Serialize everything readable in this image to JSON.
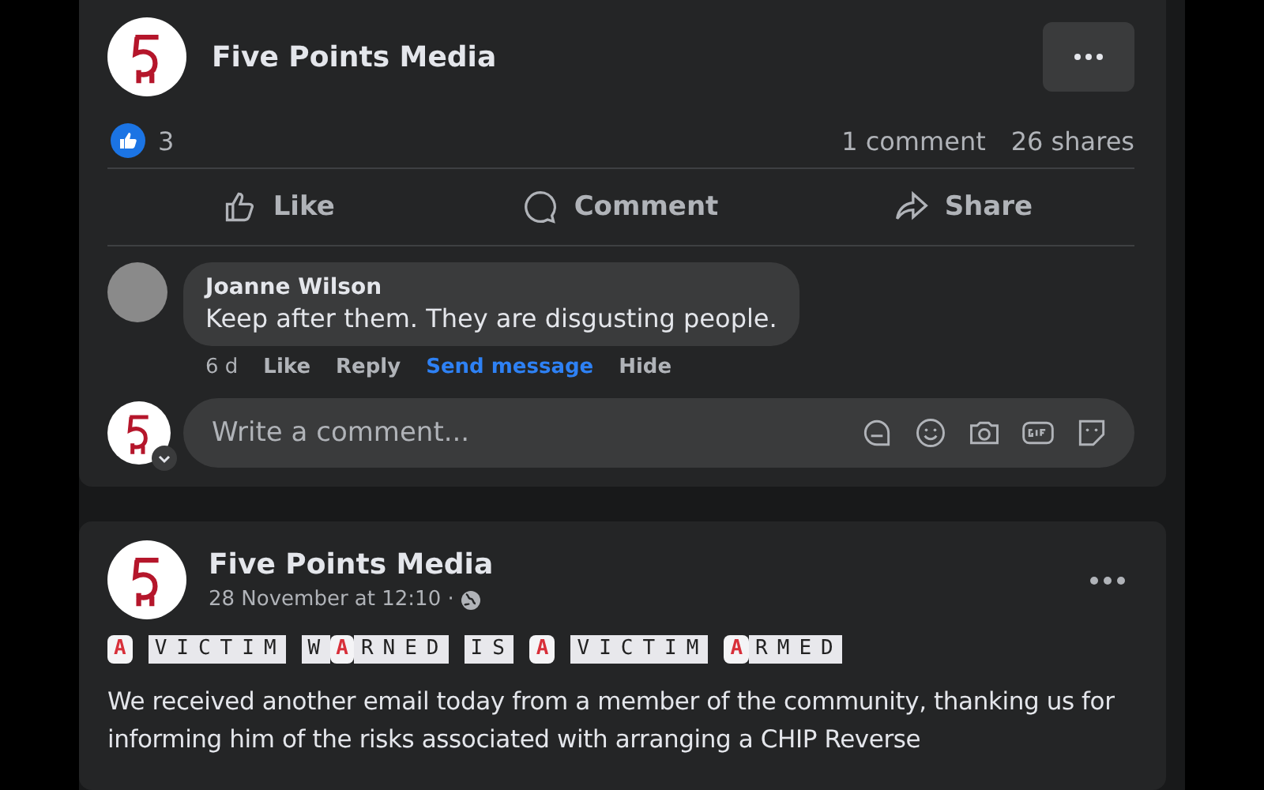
{
  "post": {
    "author": "Five Points Media",
    "reactions": {
      "count": "3"
    },
    "comments_count": "1 comment",
    "shares_count": "26 shares",
    "actions": [
      {
        "kind": "like",
        "label": "Like"
      },
      {
        "kind": "comment",
        "label": "Comment"
      },
      {
        "kind": "share",
        "label": "Share"
      }
    ],
    "comments": [
      {
        "author": "Joanne Wilson",
        "text": "Keep after them. They are disgusting people.",
        "time": "6 d",
        "actions": [
          {
            "label": "Like",
            "kind": "plain"
          },
          {
            "label": "Reply",
            "kind": "plain"
          },
          {
            "label": "Send message",
            "kind": "link"
          },
          {
            "label": "Hide",
            "kind": "plain"
          }
        ]
      }
    ],
    "composer": {
      "placeholder": "Write a comment..."
    }
  },
  "post_2": {
    "author": "Five Points Media",
    "timestamp": "28 November at 12:10 ·",
    "headline": [
      [
        {
          "text": "A",
          "kind": "red"
        }
      ],
      [
        {
          "text": "VICTIM",
          "kind": "plain"
        }
      ],
      [
        {
          "text": "W",
          "kind": "plain"
        },
        {
          "text": "A",
          "kind": "red"
        },
        {
          "text": "RNED",
          "kind": "plain"
        }
      ],
      [
        {
          "text": "IS",
          "kind": "plain"
        }
      ],
      [
        {
          "text": "A",
          "kind": "red"
        }
      ],
      [
        {
          "text": "VICTIM",
          "kind": "plain"
        }
      ],
      [
        {
          "text": "A",
          "kind": "red"
        },
        {
          "text": "RMED",
          "kind": "plain"
        }
      ]
    ],
    "body": "We received another email today from a member of the community, thanking us for informing him of the risks associated with arranging a CHIP Reverse"
  }
}
